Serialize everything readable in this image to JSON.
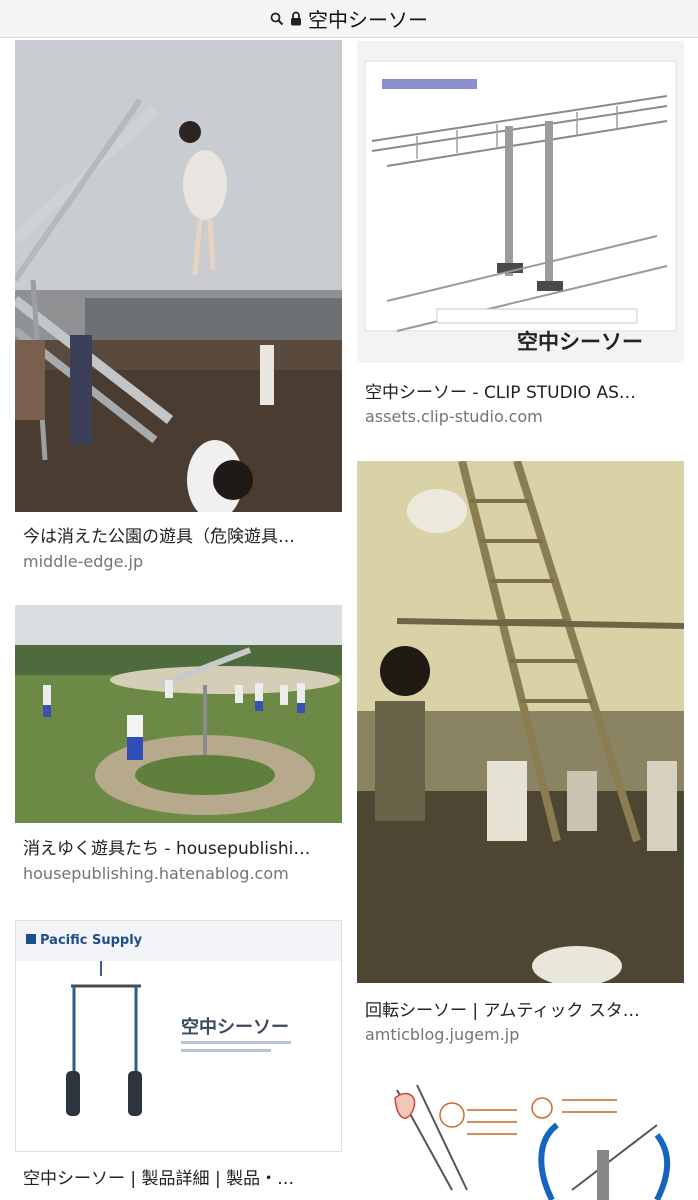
{
  "address_bar": {
    "query": "空中シーソー",
    "search_icon": "search-icon",
    "lock_icon": "lock-icon"
  },
  "results": [
    {
      "caption": "今は消えた公園の遊具（危険遊具…",
      "domain": "middle-edge.jp"
    },
    {
      "caption": "空中シーソー - CLIP STUDIO AS…",
      "domain": "assets.clip-studio.com",
      "image_title": "空中シーソー"
    },
    {
      "caption": "消えゆく遊具たち - housepublishi…",
      "domain": "housepublishing.hatenablog.com"
    },
    {
      "caption": "回転シーソー | アムティック スタ…",
      "domain": "amticblog.jugem.jp"
    },
    {
      "caption": "空中シーソー | 製品詳細 | 製品・…",
      "domain": "",
      "image_brand": "Pacific Supply",
      "image_title": "空中シーソー"
    }
  ]
}
